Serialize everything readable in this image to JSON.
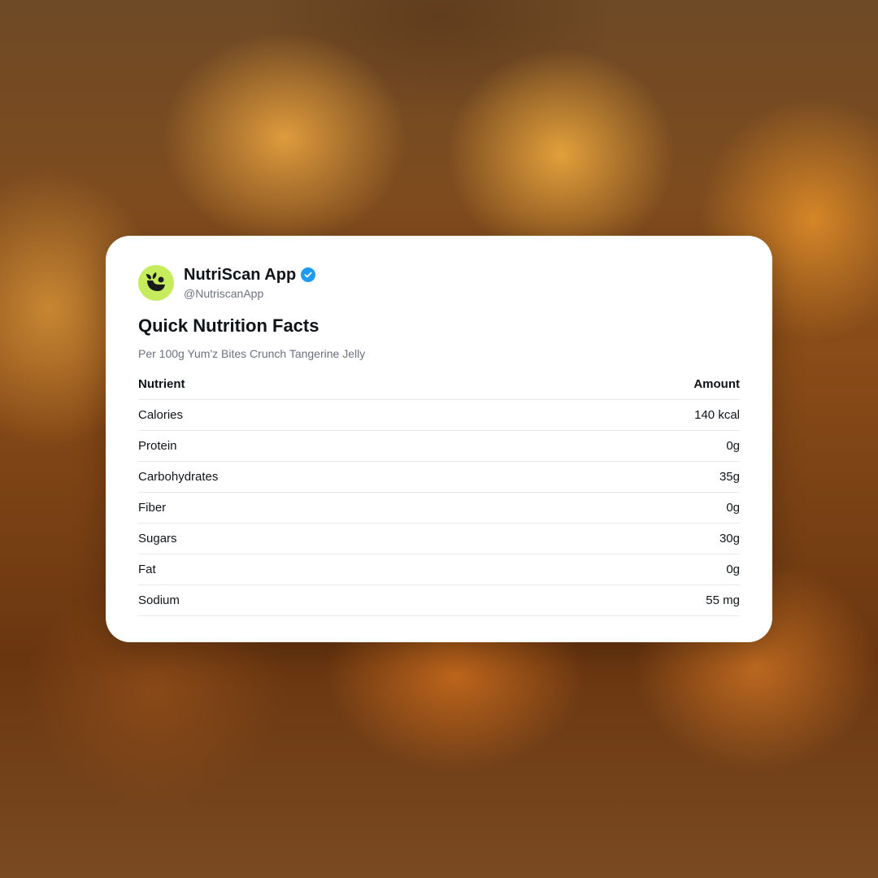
{
  "account": {
    "display_name": "NutriScan App",
    "handle": "@NutriscanApp",
    "verified": true,
    "avatar_icon": "leaf-seedling-icon",
    "avatar_color": "#c6ec5e",
    "verified_color": "#1d9bf0"
  },
  "card": {
    "title": "Quick Nutrition Facts",
    "subtitle": "Per 100g Yum'z Bites Crunch Tangerine Jelly"
  },
  "table": {
    "headers": {
      "nutrient": "Nutrient",
      "amount": "Amount"
    },
    "rows": [
      {
        "nutrient": "Calories",
        "amount": "140 kcal"
      },
      {
        "nutrient": "Protein",
        "amount": "0g"
      },
      {
        "nutrient": "Carbohydrates",
        "amount": "35g"
      },
      {
        "nutrient": "Fiber",
        "amount": "0g"
      },
      {
        "nutrient": "Sugars",
        "amount": "30g"
      },
      {
        "nutrient": "Fat",
        "amount": "0g"
      },
      {
        "nutrient": "Sodium",
        "amount": "55 mg"
      }
    ]
  }
}
